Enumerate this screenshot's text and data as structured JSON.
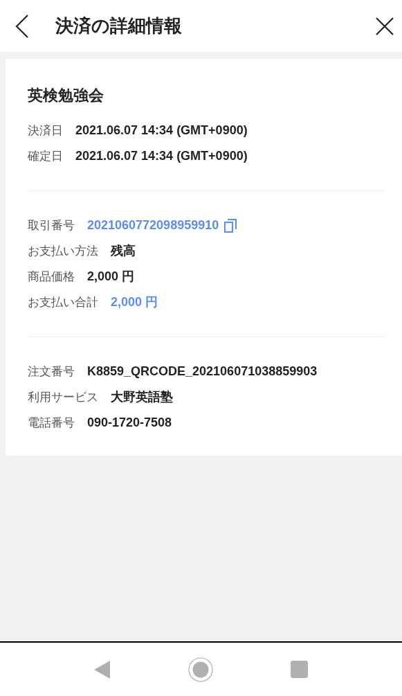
{
  "header": {
    "title": "決済の詳細情報"
  },
  "card": {
    "title": "英検勉強会",
    "sections": [
      {
        "rows": [
          {
            "label": "決済日",
            "value": "2021.06.07 14:34 (GMT+0900)",
            "kind": "plain"
          },
          {
            "label": "確定日",
            "value": "2021.06.07 14:34 (GMT+0900)",
            "kind": "plain"
          }
        ]
      },
      {
        "rows": [
          {
            "label": "取引番号",
            "value": "2021060772098959910",
            "kind": "copy"
          },
          {
            "label": "お支払い方法",
            "value": "残高",
            "kind": "plain"
          },
          {
            "label": "商品価格",
            "value": "2,000 円",
            "kind": "plain"
          },
          {
            "label": "お支払い合計",
            "value": "2,000 円",
            "kind": "accent"
          }
        ]
      },
      {
        "rows": [
          {
            "label": "注文番号",
            "value": "K8859_QRCODE_202106071038859903",
            "kind": "plain"
          },
          {
            "label": "利用サービス",
            "value": "大野英語塾",
            "kind": "plain"
          },
          {
            "label": "電話番号",
            "value": "090-1720-7508",
            "kind": "plain"
          }
        ]
      }
    ]
  }
}
